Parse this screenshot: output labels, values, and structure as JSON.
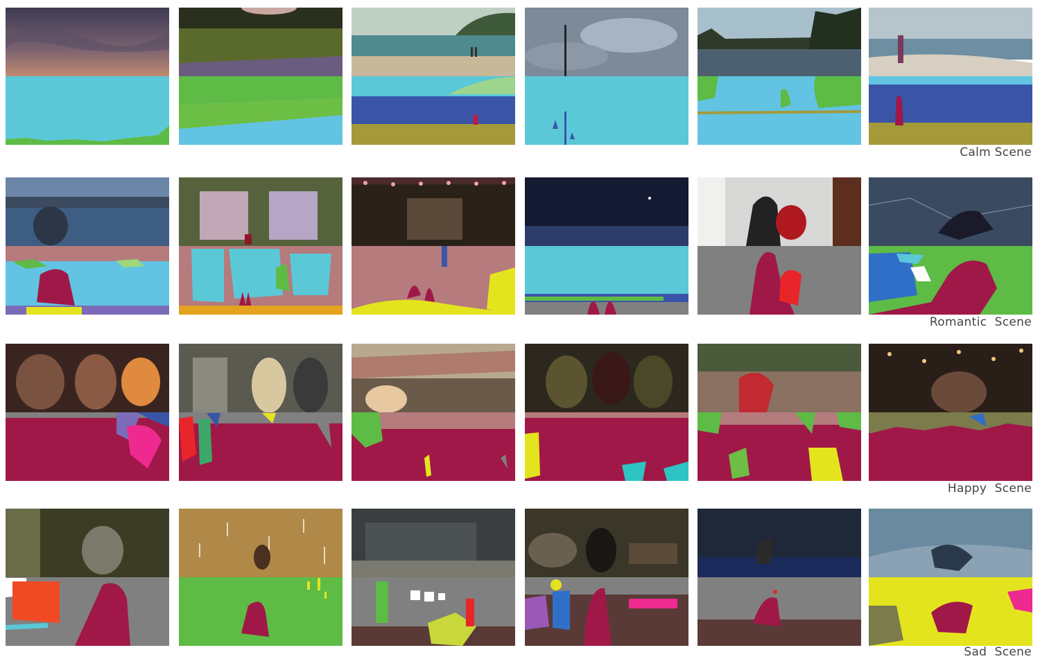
{
  "rows": [
    {
      "label": "Calm Scene"
    },
    {
      "label": "Romantic  Scene"
    },
    {
      "label": "Happy  Scene"
    },
    {
      "label": "Sad  Scene"
    }
  ],
  "segmentation_colors": {
    "sky": "#5BC8D8",
    "water": "#62C4E2",
    "vegetation": "#5DBB46",
    "grass": "#6DBE45",
    "sand": "#A49A3A",
    "sea": "#3A55A8",
    "building": "#B57B7D",
    "person": "#A01848",
    "wall": "#808080",
    "floor": "#5A3A36",
    "crowd_bg": "#7B7B4C",
    "yellow": "#E4E41E",
    "red": "#F43B3A",
    "pink": "#EE2A90"
  }
}
